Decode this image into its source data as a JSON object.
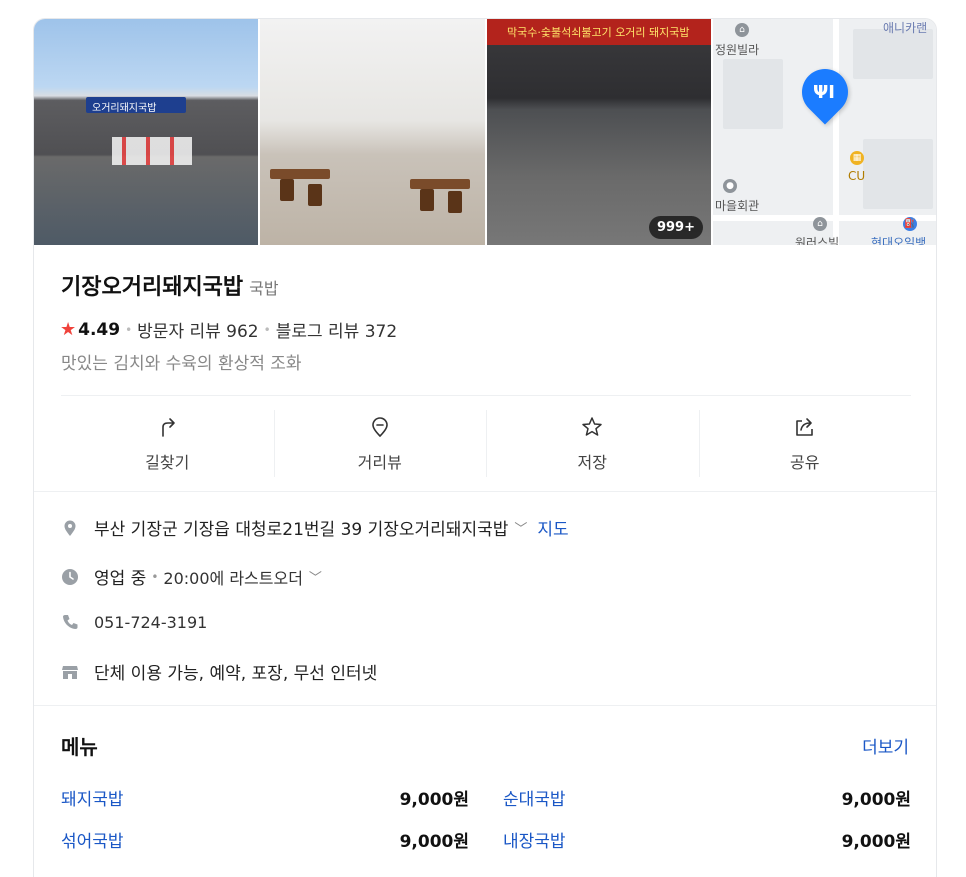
{
  "photos": {
    "photo_count": "999+",
    "storefront_sign": "오거리돼지국밥",
    "interior_banner": "막국수·숯불석쇠불고기 오거리 돼지국밥",
    "map_labels": {
      "top_left": "정원빌라",
      "top_right": "애니카랜",
      "poi_cu": "CU",
      "bottom_left": "마을회관",
      "bottom_mid": "원러스빌",
      "bottom_right": "현대오일뱅"
    }
  },
  "place": {
    "name": "기장오거리돼지국밥",
    "category": "국밥",
    "rating": "4.49",
    "visitor_reviews": "방문자 리뷰 962",
    "blog_reviews": "블로그 리뷰 372",
    "tagline": "맛있는 김치와 수육의 환상적 조화"
  },
  "actions": [
    {
      "label": "길찾기",
      "icon": "directions-icon"
    },
    {
      "label": "거리뷰",
      "icon": "streetview-icon"
    },
    {
      "label": "저장",
      "icon": "star-icon"
    },
    {
      "label": "공유",
      "icon": "share-icon"
    }
  ],
  "info": {
    "address": "부산 기장군 기장읍 대청로21번길 39 기장오거리돼지국밥",
    "map_link": "지도",
    "status": "영업 중",
    "last_order": "20:00에 라스트오더",
    "phone": "051-724-3191",
    "amenities": "단체 이용 가능, 예약, 포장, 무선 인터넷"
  },
  "menu": {
    "title": "메뉴",
    "more": "더보기",
    "items": [
      {
        "name": "돼지국밥",
        "price": "9,000원"
      },
      {
        "name": "순대국밥",
        "price": "9,000원"
      },
      {
        "name": "섞어국밥",
        "price": "9,000원"
      },
      {
        "name": "내장국밥",
        "price": "9,000원"
      }
    ]
  },
  "colors": {
    "accent_blue": "#1a57c6",
    "star_red": "#f0423b",
    "pin_blue": "#1b7cff"
  }
}
